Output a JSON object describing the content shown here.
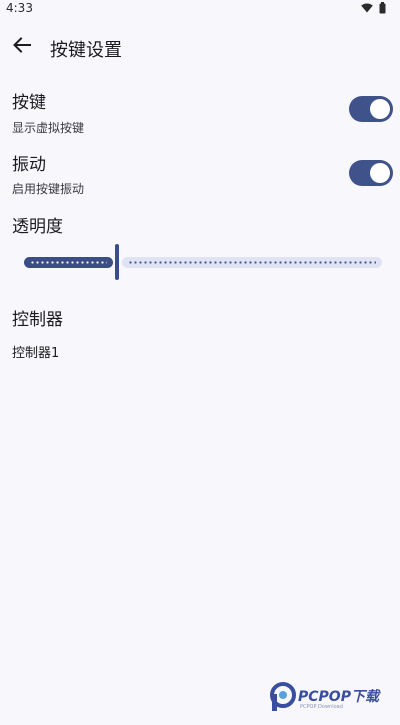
{
  "status_bar": {
    "time": "4:33",
    "wifi_icon": "wifi-icon",
    "battery_icon": "battery-icon"
  },
  "app_bar": {
    "back_icon": "arrow-back-icon",
    "title": "按键设置"
  },
  "settings": {
    "keys": {
      "title": "按键",
      "subtitle": "显示虚拟按键",
      "enabled": true
    },
    "vibration": {
      "title": "振动",
      "subtitle": "启用按键振动",
      "enabled": true
    },
    "opacity": {
      "title": "透明度",
      "value_fraction": 0.26
    }
  },
  "controllers": {
    "header": "控制器",
    "items": [
      "控制器1"
    ]
  },
  "watermark": {
    "brand": "PCPOP下载",
    "tagline": "PCPOP Download"
  },
  "colors": {
    "accent": "#3f5289",
    "background": "#f8f7fc",
    "track_inactive": "#dfe3f3"
  }
}
